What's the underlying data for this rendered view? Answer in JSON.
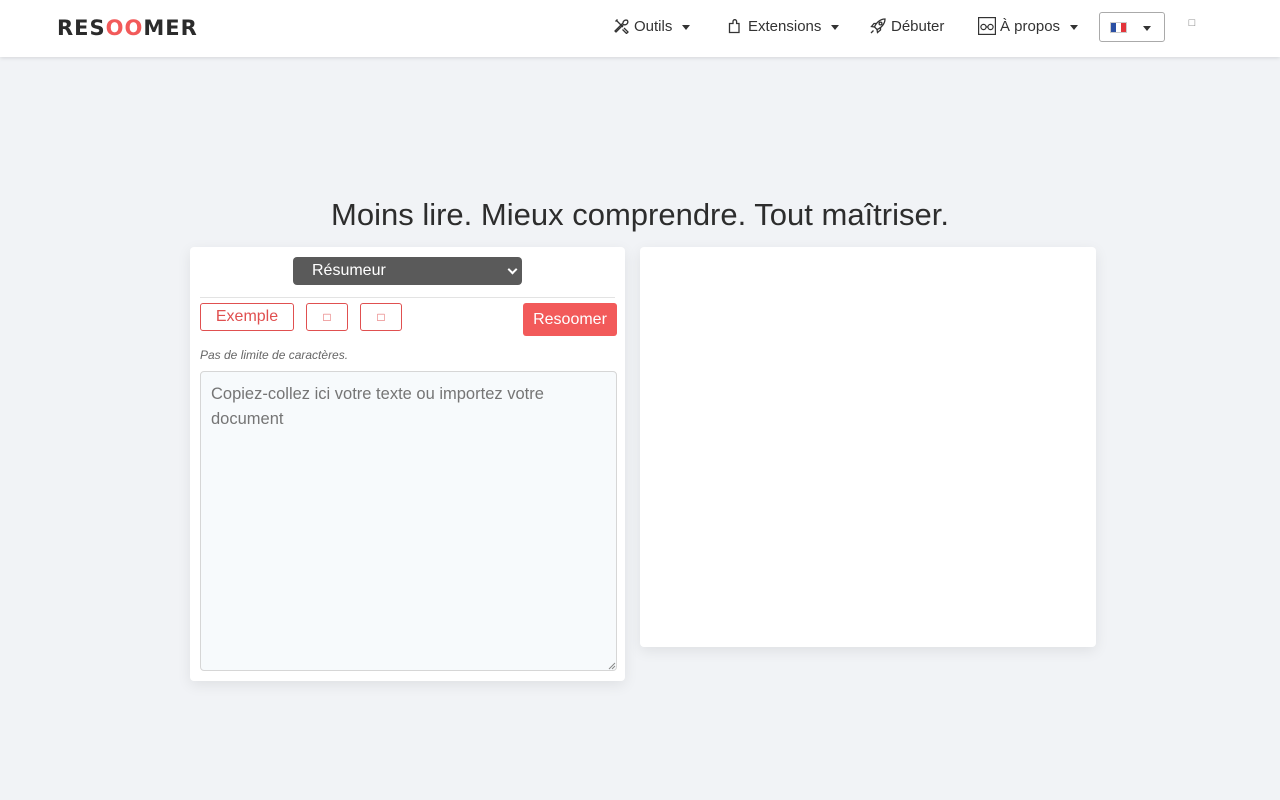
{
  "header": {
    "logo_prefix": "RES",
    "logo_oo": "OO",
    "logo_suffix": "MER",
    "nav": {
      "tools": "Outils",
      "extensions": "Extensions",
      "start": "Débuter",
      "about": "À propos"
    },
    "language_flag": "fr-flag-icon",
    "user_icon": "user-icon"
  },
  "main": {
    "headline": "Moins lire. Mieux comprendre. Tout maîtriser.",
    "mode_select": {
      "selected": "Résumeur"
    },
    "buttons": {
      "example": "Exemple",
      "icon_button_1": "",
      "icon_button_2": "",
      "submit": "Resoomer"
    },
    "hint": "Pas de limite de caractères.",
    "input": {
      "placeholder": "Copiez-collez ici votre texte ou importez votre document",
      "value": ""
    }
  },
  "colors": {
    "accent": "#f25a5a",
    "background": "#f1f3f6",
    "select_bg": "#5a5a5a"
  }
}
